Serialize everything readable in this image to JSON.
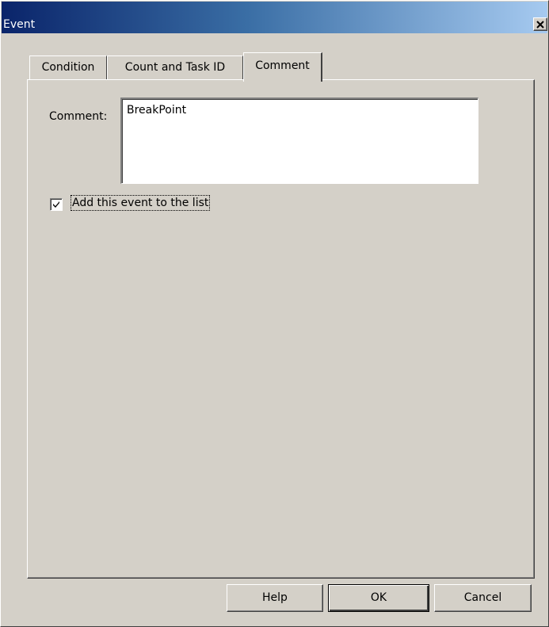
{
  "window": {
    "title": "Event",
    "close_glyph": "×"
  },
  "tabs": [
    {
      "label": "Condition",
      "selected": false
    },
    {
      "label": "Count and Task ID",
      "selected": false
    },
    {
      "label": "Comment",
      "selected": true
    }
  ],
  "comment": {
    "label": "Comment:",
    "value": "BreakPoint"
  },
  "add_to_list": {
    "label": "Add this event to the list",
    "checked": true
  },
  "buttons": {
    "help": "Help",
    "ok": "OK",
    "cancel": "Cancel"
  },
  "colors": {
    "face": "#d4d0c8",
    "title_start": "#0a246a",
    "title_end": "#a6caf0"
  },
  "icons": {
    "close": "close-icon",
    "check": "check-icon"
  }
}
